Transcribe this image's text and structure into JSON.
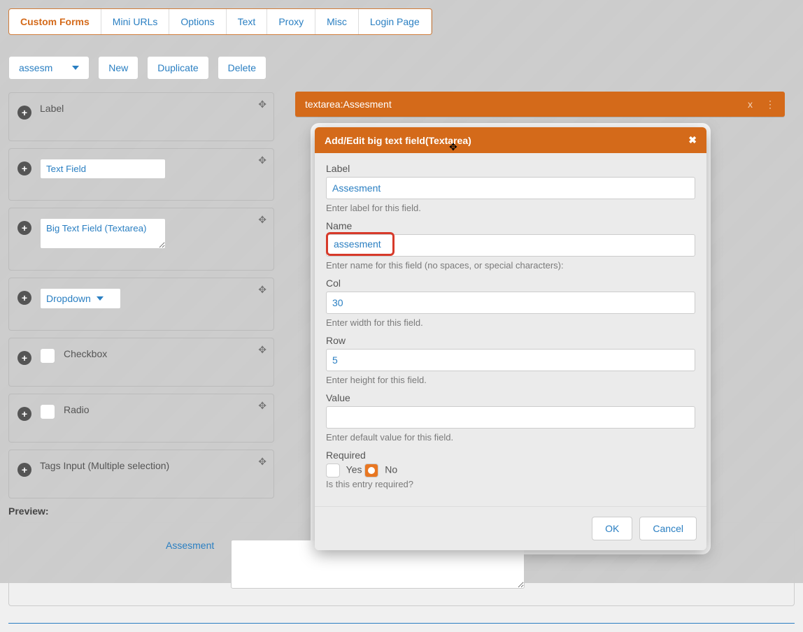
{
  "tabs": [
    "Custom Forms",
    "Mini URLs",
    "Options",
    "Text",
    "Proxy",
    "Misc",
    "Login Page"
  ],
  "activeTab": 0,
  "toolbar": {
    "select_value": "assesm",
    "new": "New",
    "duplicate": "Duplicate",
    "delete": "Delete"
  },
  "widgets": {
    "label": "Label",
    "text_field": "Text Field",
    "big_text": "Big Text Field (Textarea)",
    "dropdown": "Dropdown",
    "checkbox": "Checkbox",
    "radio": "Radio",
    "tags": "Tags Input (Multiple selection)"
  },
  "preview": {
    "title": "Preview:",
    "field_label": "Assesment"
  },
  "rightbar": {
    "title": "textarea:Assesment",
    "close": "x"
  },
  "modal": {
    "title": "Add/Edit big text field(Textarea)",
    "label": {
      "label": "Label",
      "value": "Assesment",
      "hint": "Enter label for this field."
    },
    "name": {
      "label": "Name",
      "value": "assesment",
      "hint": "Enter name for this field (no spaces, or special characters):"
    },
    "col": {
      "label": "Col",
      "value": "30",
      "hint": "Enter width for this field."
    },
    "row": {
      "label": "Row",
      "value": "5",
      "hint": "Enter height for this field."
    },
    "value": {
      "label": "Value",
      "value": "",
      "hint": "Enter default value for this field."
    },
    "required": {
      "label": "Required",
      "yes": "Yes",
      "no": "No",
      "hint": "Is this entry required?",
      "selected": "no"
    },
    "ok": "OK",
    "cancel": "Cancel"
  }
}
